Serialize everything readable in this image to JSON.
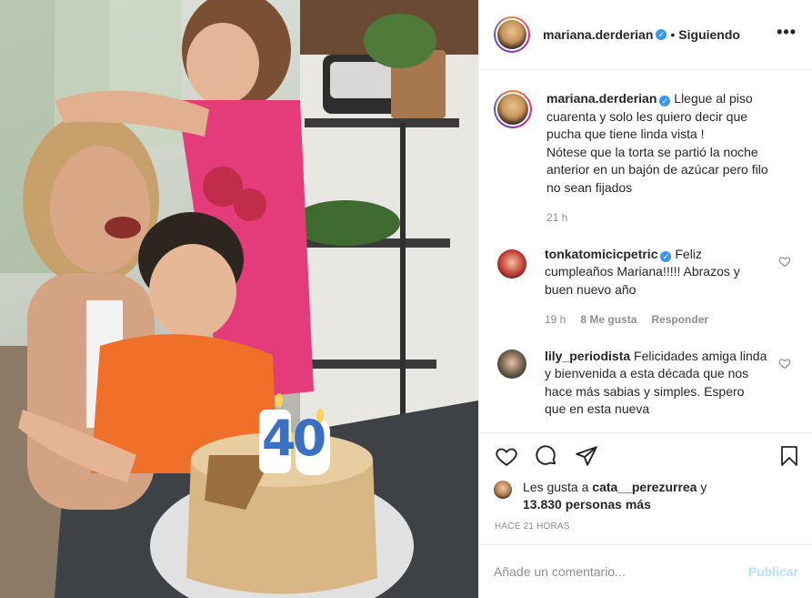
{
  "header": {
    "username": "mariana.derderian",
    "separator": "•",
    "follow_status": "Siguiendo",
    "more": "•••"
  },
  "caption": {
    "username": "mariana.derderian",
    "text": "Llegue al piso cuarenta y solo les quiero decir que pucha que tiene linda vista !\nNótese que la torta se partió la noche anterior en un bajón de azúcar pero filo no sean fijados",
    "time": "21 h"
  },
  "comments": [
    {
      "username": "tonkatomicicpetric",
      "verified": true,
      "text": "Feliz cumpleaños Mariana!!!!! Abrazos y buen nuevo año",
      "time": "19 h",
      "likes": "8 Me gusta",
      "reply": "Responder"
    },
    {
      "username": "lily_periodista",
      "verified": false,
      "text": "Felicidades amiga linda y bienvenida a esta década que nos hace más sabias y simples. Espero que en esta nueva",
      "time": "",
      "likes": "",
      "reply": ""
    }
  ],
  "likes": {
    "prefix": "Les gusta a ",
    "user": "cata__perezurrea",
    "middle": " y",
    "count": "13.830 personas más"
  },
  "time_ago": "HACE 21 HORAS",
  "add_comment": {
    "placeholder": "Añade un comentario...",
    "publish": "Publicar"
  },
  "photo": {
    "candle_number": "40"
  },
  "colors": {
    "accent": "#3897f0",
    "publish_disabled": "#b2dffc",
    "secondary_text": "#8e8e8e",
    "divider": "#efefef"
  }
}
